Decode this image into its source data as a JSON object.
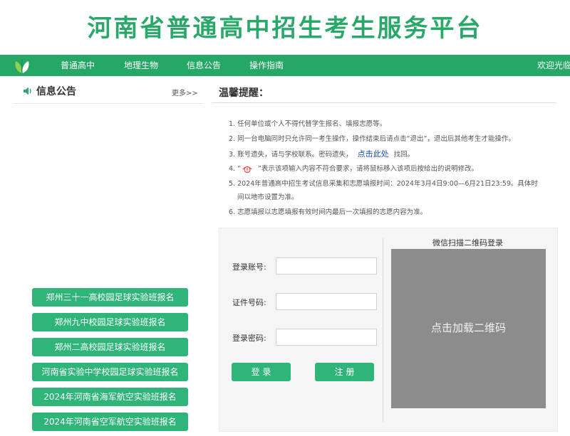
{
  "header": {
    "title": "河南省普通高中招生考生服务平台"
  },
  "nav": {
    "items": [
      "普通高中",
      "地理生物",
      "信息公告",
      "操作指南"
    ],
    "welcome": "欢迎光临"
  },
  "notices": {
    "title": "信息公告",
    "more": "更多>>",
    "buttons": [
      "郑州三十一高校园足球实验班报名",
      "郑州九中校园足球实验班报名",
      "郑州二高校园足球实验班报名",
      "河南省实验中学校园足球实验班报名",
      "2024年河南省海军航空实验班报名",
      "2024年河南省空军航空实验班报名"
    ]
  },
  "tips": {
    "title": "温馨提醒：",
    "items": {
      "t1": "1. 任何单位或个人不得代替学生报名、填报志愿等。",
      "t2": "2. 同一台电脑同时只允许同一考生操作，操作结束后请点击“退出”，退出后其他考生才能操作。",
      "t3_pre": "3. 账号遗失，请与学校联系。密码遗失，",
      "t3_link": "点击此处",
      "t3_post": "找回。",
      "t4_pre": "4. “",
      "t4_post": "”表示该项输入内容不符合要求，请将鼠标移入该项后按给出的说明修改。",
      "t5_line1": "5. 2024年普通高中招生考试信息采集和志愿填报时间：2024年3月4日9:00—6月21日23:59。具体时",
      "t5_line2": "间以地市设置为准。",
      "t6": "6. 志愿填报以志愿填报有效时间内最后一次填报的志愿内容为准。"
    }
  },
  "login": {
    "account_label": "登录账号:",
    "id_label": "证件号码:",
    "password_label": "登录密码:",
    "account_value": "",
    "id_value": "",
    "password_value": "",
    "login_button": "登 录",
    "register_button": "注 册"
  },
  "qr": {
    "title": "微信扫描二维码登录",
    "placeholder": "点击加载二维码"
  },
  "colors": {
    "brand_green": "#25a765",
    "button_green": "#2fb57a",
    "link_blue": "#1a4bbb",
    "warning_red": "#e03b3b"
  }
}
